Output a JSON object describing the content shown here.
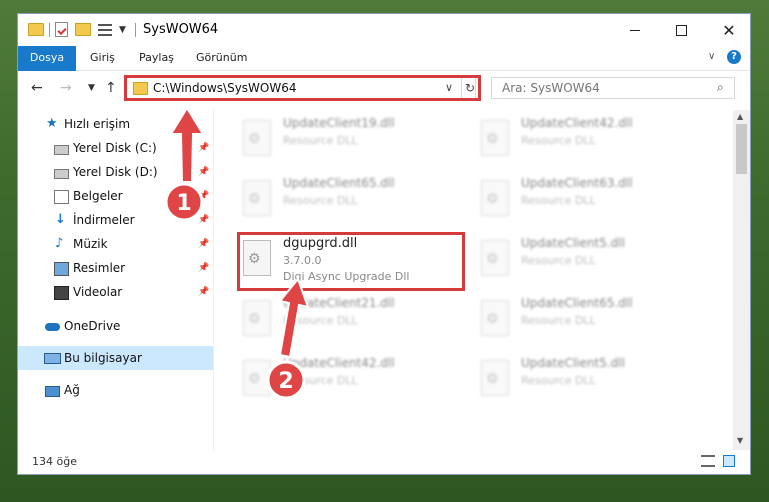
{
  "window": {
    "title": "SysWOW64"
  },
  "ribbon": {
    "tabs": [
      "Dosya",
      "Giriş",
      "Paylaş",
      "Görünüm"
    ]
  },
  "nav": {
    "address": "C:\\Windows\\SysWOW64",
    "search_placeholder": "Ara: SysWOW64"
  },
  "sidebar": {
    "items": [
      {
        "label": "Hızlı erişim"
      },
      {
        "label": "Yerel Disk (C:)"
      },
      {
        "label": "Yerel Disk (D:)"
      },
      {
        "label": "Belgeler"
      },
      {
        "label": "İndirmeler"
      },
      {
        "label": "Müzik"
      },
      {
        "label": "Resimler"
      },
      {
        "label": "Videolar"
      },
      {
        "label": "OneDrive"
      },
      {
        "label": "Bu bilgisayar"
      },
      {
        "label": "Ağ"
      }
    ]
  },
  "files": [
    {
      "name": "UpdateClient19.dll",
      "desc": "Resource DLL"
    },
    {
      "name": "UpdateClient42.dll",
      "desc": "Resource DLL"
    },
    {
      "name": "UpdateClient65.dll",
      "desc": "Resource DLL"
    },
    {
      "name": "UpdateClient63.dll",
      "desc": "Resource DLL"
    },
    {
      "name": "dgupgrd.dll",
      "version": "3.7.0.0",
      "desc": "Digi Async Upgrade Dll"
    },
    {
      "name": "UpdateClient5.dll",
      "desc": "Resource DLL"
    },
    {
      "name": "UpdateClient21.dll",
      "desc": "Resource DLL"
    },
    {
      "name": "UpdateClient65.dll",
      "desc": "Resource DLL"
    },
    {
      "name": "UpdateClient42.dll",
      "desc": "Resource DLL"
    },
    {
      "name": "UpdateClient5.dll",
      "desc": "Resource DLL"
    }
  ],
  "status": {
    "count": "134 öğe"
  },
  "annotations": {
    "step1": "1",
    "step2": "2"
  },
  "colors": {
    "accent": "#1979ca",
    "highlight": "#d63a3a"
  }
}
